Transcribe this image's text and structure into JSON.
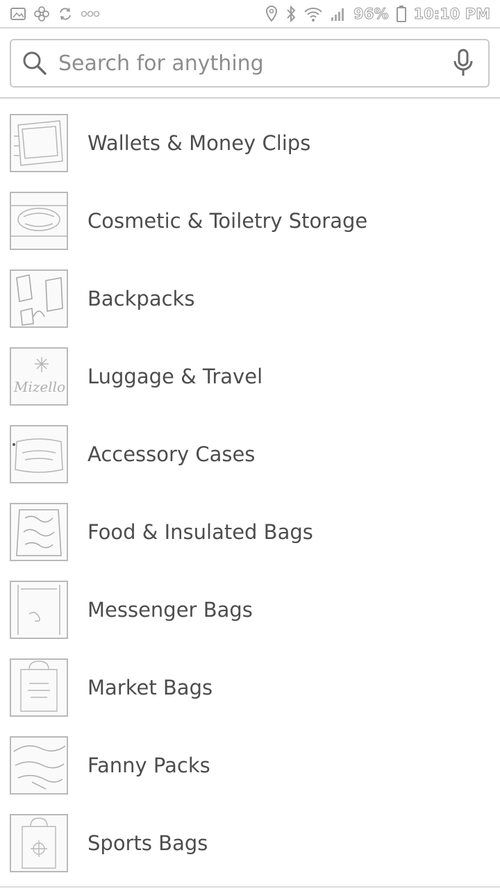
{
  "status_bar": {
    "battery": "96%",
    "time": "10:10 PM",
    "icons": [
      "picture-icon",
      "pinwheel-icon",
      "sync-icon",
      "more-dots-icon",
      "location-icon",
      "bluetooth-icon",
      "wifi-icon",
      "signal-icon",
      "battery-icon"
    ]
  },
  "search": {
    "placeholder": "Search for anything",
    "value": "",
    "icons": [
      "search-icon",
      "microphone-icon"
    ]
  },
  "categories": [
    {
      "label": "Wallets & Money Clips",
      "thumb": "wallet-thumbnail"
    },
    {
      "label": "Cosmetic & Toiletry Storage",
      "thumb": "cosmetic-bag-thumbnail"
    },
    {
      "label": "Backpacks",
      "thumb": "backpack-thumbnail"
    },
    {
      "label": "Luggage & Travel",
      "thumb": "luggage-thumbnail",
      "thumb_text": "Mizello"
    },
    {
      "label": "Accessory Cases",
      "thumb": "accessory-case-thumbnail"
    },
    {
      "label": "Food & Insulated Bags",
      "thumb": "food-bag-thumbnail"
    },
    {
      "label": "Messenger Bags",
      "thumb": "messenger-bag-thumbnail"
    },
    {
      "label": "Market Bags",
      "thumb": "market-bag-thumbnail"
    },
    {
      "label": "Fanny Packs",
      "thumb": "fanny-pack-thumbnail"
    },
    {
      "label": "Sports Bags",
      "thumb": "sports-bag-thumbnail"
    }
  ],
  "colors": {
    "text": "#4d4d4d",
    "placeholder": "#8d8d8d",
    "border": "#c9c9c9"
  }
}
